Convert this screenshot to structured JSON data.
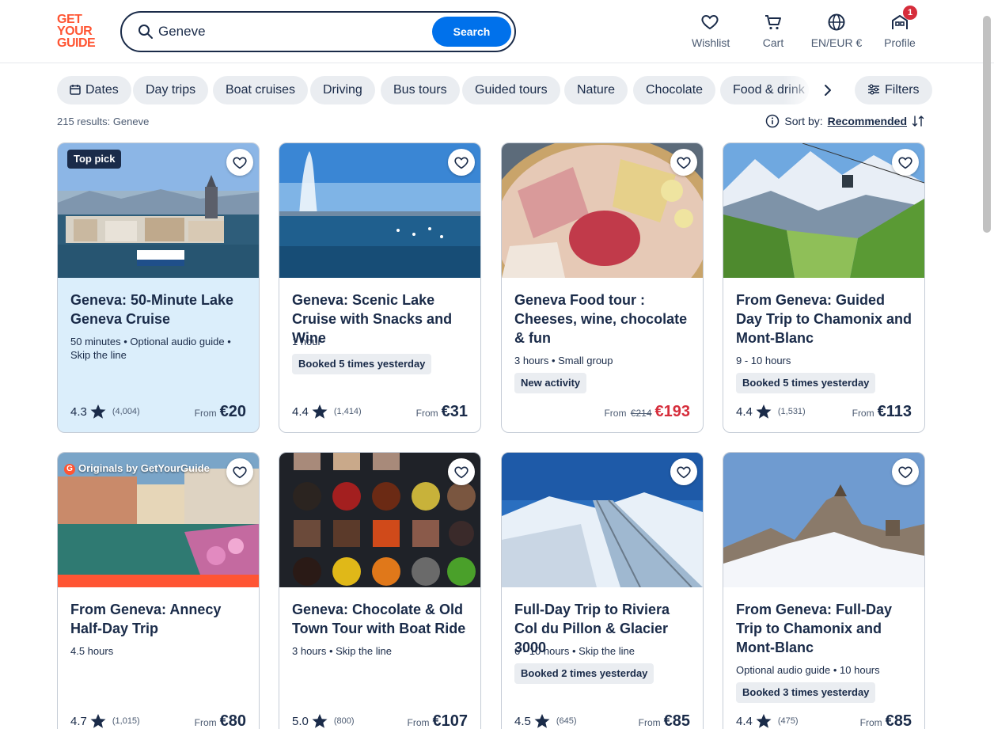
{
  "logo": [
    "GET",
    "YOUR",
    "GUIDE"
  ],
  "search": {
    "value": "Geneve",
    "button_label": "Search"
  },
  "nav": {
    "wishlist": "Wishlist",
    "cart": "Cart",
    "locale": "EN/EUR €",
    "profile": "Profile",
    "profile_badge": "1"
  },
  "chips": [
    "Dates",
    "Day trips",
    "Boat cruises",
    "Driving",
    "Bus tours",
    "Guided tours",
    "Nature",
    "Chocolate",
    "Food & drink"
  ],
  "filters_label": "Filters",
  "results_text": "215 results: Geneve",
  "sort": {
    "label": "Sort by:",
    "value": "Recommended"
  },
  "colors": {
    "brand": "#ff5533",
    "primary": "#0071eb",
    "text": "#1a2b49",
    "sale": "#d62d3b",
    "highlight": "#dbeefb"
  },
  "cards": [
    {
      "tag": "Top pick",
      "title": "Geneva: 50-Minute Lake Geneva Cruise",
      "meta": "50 minutes • Optional audio guide • Skip the line",
      "pill": "",
      "rating": "4.3",
      "reviews": "(4,004)",
      "price_from": "From",
      "price": "€20"
    },
    {
      "title": "Geneva: Scenic Lake Cruise with Snacks and Wine",
      "meta": "1 hour",
      "pill": "Booked 5 times yesterday",
      "rating": "4.4",
      "reviews": "(1,414)",
      "price_from": "From",
      "price": "€31"
    },
    {
      "title": "Geneva Food tour : Cheeses, wine, chocolate & fun",
      "meta": "3 hours • Small group",
      "pill": "New activity",
      "price_from": "From",
      "price_old": "€214",
      "price": "€193"
    },
    {
      "title": "From Geneva: Guided Day Trip to Chamonix and Mont-Blanc",
      "meta": "9 - 10 hours",
      "pill": "Booked 5 times yesterday",
      "rating": "4.4",
      "reviews": "(1,531)",
      "price_from": "From",
      "price": "€113"
    },
    {
      "tag": "Originals by GetYourGuide",
      "title": "From Geneva: Annecy Half-Day Trip",
      "meta": "4.5 hours",
      "rating": "4.7",
      "reviews": "(1,015)",
      "price_from": "From",
      "price": "€80"
    },
    {
      "title": "Geneva: Chocolate & Old Town Tour with Boat Ride",
      "meta": "3 hours • Skip the line",
      "rating": "5.0",
      "reviews": "(800)",
      "price_from": "From",
      "price": "€107"
    },
    {
      "title": "Full-Day Trip to Riviera Col du Pillon & Glacier 3000",
      "meta": "6 - 10 hours • Skip the line",
      "pill": "Booked 2 times yesterday",
      "rating": "4.5",
      "reviews": "(645)",
      "price_from": "From",
      "price": "€85"
    },
    {
      "title": "From Geneva: Full-Day Trip to Chamonix and Mont-Blanc",
      "meta": "Optional audio guide • 10 hours",
      "pill": "Booked 3 times yesterday",
      "rating": "4.4",
      "reviews": "(475)",
      "price_from": "From",
      "price": "€85"
    }
  ]
}
